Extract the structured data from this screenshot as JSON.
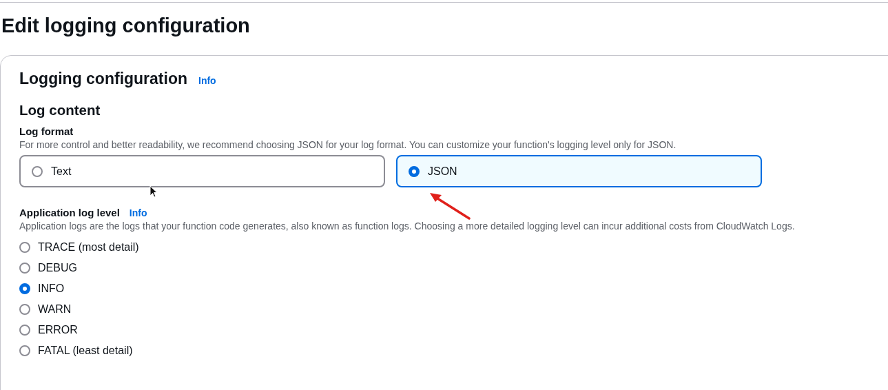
{
  "page_title": "Edit logging configuration",
  "section": {
    "title": "Logging configuration",
    "info_link": "Info"
  },
  "log_content": {
    "heading": "Log content",
    "log_format": {
      "label": "Log format",
      "description": "For more control and better readability, we recommend choosing JSON for your log format. You can customize your function's logging level only for JSON.",
      "options": [
        {
          "label": "Text",
          "selected": false
        },
        {
          "label": "JSON",
          "selected": true
        }
      ]
    },
    "application_log_level": {
      "label": "Application log level",
      "info_link": "Info",
      "description": "Application logs are the logs that your function code generates, also known as function logs. Choosing a more detailed logging level can incur additional costs from CloudWatch Logs.",
      "options": [
        {
          "label": "TRACE (most detail)",
          "selected": false
        },
        {
          "label": "DEBUG",
          "selected": false
        },
        {
          "label": "INFO",
          "selected": true
        },
        {
          "label": "WARN",
          "selected": false
        },
        {
          "label": "ERROR",
          "selected": false
        },
        {
          "label": "FATAL (least detail)",
          "selected": false
        }
      ]
    }
  }
}
